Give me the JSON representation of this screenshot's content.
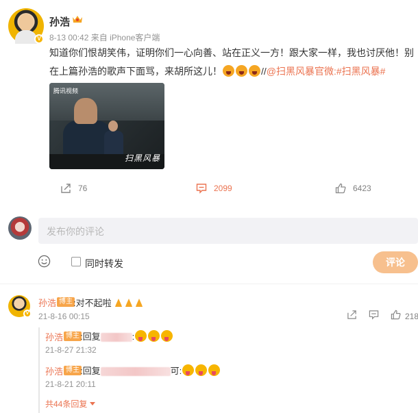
{
  "post": {
    "username": "孙浩",
    "timestamp": "8-13 00:42",
    "source": "来自 iPhone客户端",
    "text_main": "知道你们恨胡笑伟，证明你们一心向善、站在正义一方！跟大家一样，我也讨厌他！别在上篇孙浩的歌声下面骂，来胡所这儿！",
    "text_sep": "//",
    "mention": "@扫黑风暴官微",
    "hashtag": ":#扫黑风暴#",
    "video": {
      "platform_label": "腾讯视频",
      "watermark": "扫黑风暴"
    }
  },
  "actions": {
    "forward_count": "76",
    "comment_count": "2099",
    "like_count": "6423"
  },
  "composer": {
    "placeholder": "发布你的评论",
    "forward_label": "同时转发",
    "submit_label": "评论"
  },
  "comments": [
    {
      "author": "孙浩",
      "tag": "博主",
      "text": ":对不起啦",
      "time": "21-8-16 00:15",
      "likes": "218",
      "replies": [
        {
          "author": "孙浩",
          "tag": "博主",
          "text": ":回复",
          "time": "21-8-27 21:32"
        },
        {
          "author": "孙浩",
          "tag": "博主",
          "text": ":回复",
          "tail": "可:",
          "time": "21-8-21 20:11"
        }
      ],
      "more_replies": "共44条回复"
    }
  ],
  "colors": {
    "accent": "#eb7350",
    "submit_bg": "#f7c08e",
    "blogger_tag": "#f7a54a"
  }
}
